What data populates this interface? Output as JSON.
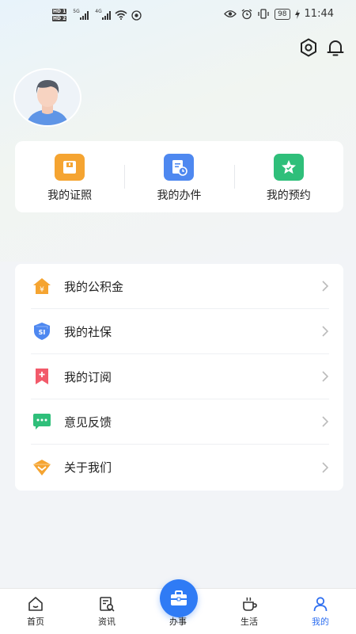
{
  "status_bar": {
    "hd1": "HD 1",
    "hd2": "HD 2",
    "sig1_label": "5G",
    "sig2_label": "4G",
    "battery": "98",
    "time": "11:44"
  },
  "header": {
    "settings_icon": "settings-hexagon-icon",
    "bell_icon": "bell-icon"
  },
  "quick_actions": [
    {
      "label": "我的证照",
      "icon": "license-icon",
      "color": "#f5a431"
    },
    {
      "label": "我的办件",
      "icon": "document-clock-icon",
      "color": "#4e88f0"
    },
    {
      "label": "我的预约",
      "icon": "star-icon",
      "color": "#2fbf7a"
    }
  ],
  "menu": [
    {
      "label": "我的公积金",
      "icon": "housing-fund-icon",
      "color": "#f5a431"
    },
    {
      "label": "我的社保",
      "icon": "social-security-icon",
      "color": "#4e88f0"
    },
    {
      "label": "我的订阅",
      "icon": "subscribe-icon",
      "color": "#f25a6a"
    },
    {
      "label": "意见反馈",
      "icon": "feedback-icon",
      "color": "#2fbf7a"
    },
    {
      "label": "关于我们",
      "icon": "about-icon",
      "color": "#f5a431"
    }
  ],
  "bottom_nav": {
    "items": [
      {
        "label": "首页",
        "icon": "home-icon"
      },
      {
        "label": "资讯",
        "icon": "news-icon"
      },
      {
        "label": "办事",
        "icon": "briefcase-icon"
      },
      {
        "label": "生活",
        "icon": "coffee-cup-icon"
      },
      {
        "label": "我的",
        "icon": "user-icon"
      }
    ],
    "active_color": "#2f6ff0"
  }
}
